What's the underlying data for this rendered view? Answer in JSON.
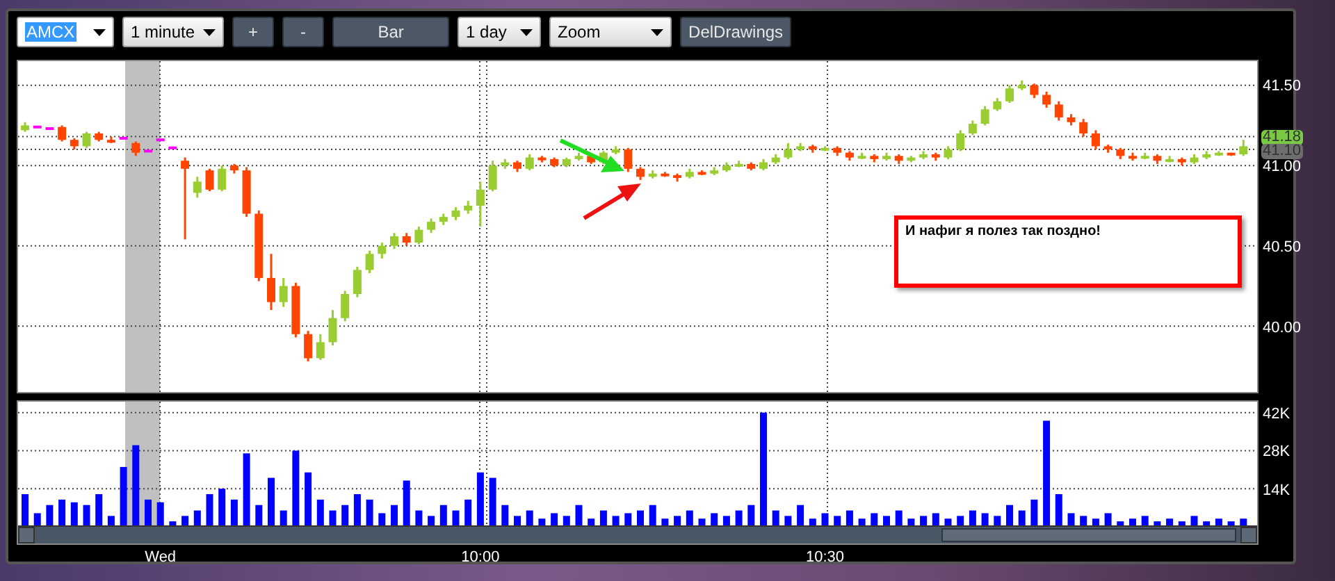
{
  "toolbar": {
    "controls": [
      {
        "kind": "input",
        "label": "AMCX",
        "text_selected": true
      },
      {
        "kind": "select",
        "label": "1 minute"
      },
      {
        "kind": "button",
        "label": "+"
      },
      {
        "kind": "button",
        "label": "-"
      },
      {
        "kind": "wide_button",
        "label": "Bar"
      },
      {
        "kind": "select",
        "label": "1 day"
      },
      {
        "kind": "wide_select",
        "label": "Zoom"
      },
      {
        "kind": "button",
        "label": "DelDrawings"
      }
    ]
  },
  "price_chart": {
    "chart_data": {
      "type": "candlestick",
      "grid": true,
      "ylim": [
        39.59,
        41.65
      ],
      "yticks": [
        {
          "value": 41.5,
          "label": "41.50"
        },
        {
          "value": 41.0,
          "label": "41.00"
        },
        {
          "value": 40.5,
          "label": "40.50"
        },
        {
          "value": 40.0,
          "label": "40.00"
        }
      ],
      "ohlc": [
        [
          41.22,
          41.27,
          41.21,
          41.25
        ],
        [
          41.24,
          41.24,
          41.24,
          41.24
        ],
        [
          41.23,
          41.23,
          41.23,
          41.23
        ],
        [
          41.24,
          41.25,
          41.15,
          41.16
        ],
        [
          41.16,
          41.17,
          41.1,
          41.12
        ],
        [
          41.12,
          41.21,
          41.11,
          41.2
        ],
        [
          41.2,
          41.21,
          41.15,
          41.16
        ],
        [
          41.16,
          41.18,
          41.14,
          41.15
        ],
        [
          41.17,
          41.17,
          41.17,
          41.17
        ],
        [
          41.14,
          41.15,
          41.06,
          41.08
        ],
        [
          41.09,
          41.09,
          41.09,
          41.09
        ],
        [
          41.16,
          41.16,
          41.16,
          41.16
        ],
        [
          41.11,
          41.11,
          41.11,
          41.11
        ],
        [
          41.03,
          41.05,
          40.54,
          40.98
        ],
        [
          40.83,
          40.93,
          40.8,
          40.9
        ],
        [
          40.97,
          40.98,
          40.84,
          40.85
        ],
        [
          40.85,
          41.0,
          40.84,
          40.98
        ],
        [
          41.0,
          41.01,
          40.95,
          40.97
        ],
        [
          40.97,
          40.99,
          40.68,
          40.7
        ],
        [
          40.7,
          40.72,
          40.28,
          40.3
        ],
        [
          40.3,
          40.45,
          40.1,
          40.15
        ],
        [
          40.15,
          40.3,
          40.12,
          40.25
        ],
        [
          40.25,
          40.27,
          39.93,
          39.95
        ],
        [
          39.95,
          39.97,
          39.78,
          39.8
        ],
        [
          39.8,
          39.95,
          39.79,
          39.9
        ],
        [
          39.9,
          40.1,
          39.88,
          40.05
        ],
        [
          40.05,
          40.22,
          40.03,
          40.2
        ],
        [
          40.2,
          40.37,
          40.18,
          40.35
        ],
        [
          40.35,
          40.47,
          40.33,
          40.45
        ],
        [
          40.45,
          40.52,
          40.42,
          40.5
        ],
        [
          40.5,
          40.58,
          40.48,
          40.56
        ],
        [
          40.56,
          40.58,
          40.5,
          40.52
        ],
        [
          40.52,
          40.62,
          40.51,
          40.6
        ],
        [
          40.6,
          40.67,
          40.58,
          40.65
        ],
        [
          40.65,
          40.7,
          40.63,
          40.68
        ],
        [
          40.68,
          40.74,
          40.66,
          40.72
        ],
        [
          40.72,
          40.78,
          40.7,
          40.75
        ],
        [
          40.75,
          40.9,
          40.62,
          40.85
        ],
        [
          40.85,
          41.03,
          40.84,
          41.0
        ],
        [
          41.0,
          41.04,
          40.98,
          41.02
        ],
        [
          41.02,
          41.03,
          40.96,
          40.98
        ],
        [
          40.98,
          41.07,
          40.97,
          41.05
        ],
        [
          41.05,
          41.06,
          41.02,
          41.04
        ],
        [
          41.04,
          41.05,
          40.99,
          41.0
        ],
        [
          41.0,
          41.05,
          40.99,
          41.04
        ],
        [
          41.04,
          41.08,
          41.03,
          41.06
        ],
        [
          41.06,
          41.07,
          41.01,
          41.02
        ],
        [
          41.02,
          41.09,
          41.01,
          41.08
        ],
        [
          41.08,
          41.12,
          41.07,
          41.1
        ],
        [
          41.1,
          41.11,
          40.96,
          40.98
        ],
        [
          40.98,
          40.99,
          40.91,
          40.93
        ],
        [
          40.93,
          40.97,
          40.92,
          40.95
        ],
        [
          40.95,
          40.96,
          40.93,
          40.94
        ],
        [
          40.94,
          40.95,
          40.9,
          40.93
        ],
        [
          40.93,
          40.98,
          40.92,
          40.96
        ],
        [
          40.96,
          40.97,
          40.94,
          40.95
        ],
        [
          40.95,
          40.99,
          40.94,
          40.97
        ],
        [
          40.97,
          41.02,
          40.96,
          41.0
        ],
        [
          41.0,
          41.03,
          40.99,
          41.01
        ],
        [
          41.01,
          41.02,
          40.97,
          40.98
        ],
        [
          40.98,
          41.04,
          40.97,
          41.02
        ],
        [
          41.02,
          41.07,
          41.01,
          41.05
        ],
        [
          41.05,
          41.14,
          41.04,
          41.1
        ],
        [
          41.1,
          41.14,
          41.09,
          41.12
        ],
        [
          41.12,
          41.13,
          41.08,
          41.1
        ],
        [
          41.1,
          41.12,
          41.09,
          41.11
        ],
        [
          41.11,
          41.12,
          41.06,
          41.08
        ],
        [
          41.08,
          41.09,
          41.03,
          41.05
        ],
        [
          41.05,
          41.08,
          41.04,
          41.06
        ],
        [
          41.06,
          41.07,
          41.02,
          41.04
        ],
        [
          41.04,
          41.08,
          41.03,
          41.06
        ],
        [
          41.06,
          41.07,
          41.01,
          41.03
        ],
        [
          41.03,
          41.06,
          41.02,
          41.05
        ],
        [
          41.05,
          41.09,
          41.04,
          41.07
        ],
        [
          41.07,
          41.08,
          41.03,
          41.05
        ],
        [
          41.05,
          41.12,
          41.04,
          41.1
        ],
        [
          41.1,
          41.22,
          41.09,
          41.2
        ],
        [
          41.2,
          41.28,
          41.19,
          41.26
        ],
        [
          41.26,
          41.37,
          41.25,
          41.35
        ],
        [
          41.35,
          41.42,
          41.34,
          41.4
        ],
        [
          41.4,
          41.5,
          41.39,
          41.48
        ],
        [
          41.48,
          41.53,
          41.47,
          41.5
        ],
        [
          41.5,
          41.51,
          41.42,
          41.44
        ],
        [
          41.44,
          41.46,
          41.36,
          41.38
        ],
        [
          41.38,
          41.4,
          41.28,
          41.3
        ],
        [
          41.3,
          41.32,
          41.25,
          41.27
        ],
        [
          41.27,
          41.29,
          41.18,
          41.2
        ],
        [
          41.2,
          41.22,
          41.1,
          41.12
        ],
        [
          41.12,
          41.13,
          41.08,
          41.1
        ],
        [
          41.1,
          41.11,
          41.04,
          41.06
        ],
        [
          41.06,
          41.08,
          41.03,
          41.05
        ],
        [
          41.05,
          41.08,
          41.04,
          41.06
        ],
        [
          41.06,
          41.07,
          41.01,
          41.03
        ],
        [
          41.03,
          41.06,
          41.02,
          41.04
        ],
        [
          41.04,
          41.05,
          41.0,
          41.02
        ],
        [
          41.02,
          41.07,
          41.01,
          41.05
        ],
        [
          41.05,
          41.09,
          41.04,
          41.07
        ],
        [
          41.07,
          41.09,
          41.06,
          41.08
        ],
        [
          41.08,
          41.08,
          41.06,
          41.07
        ],
        [
          41.07,
          41.16,
          41.06,
          41.12
        ]
      ]
    },
    "last_tags": [
      {
        "label": "41.18",
        "color": "#7ac943"
      },
      {
        "label": "41.10",
        "color": "#6e6e6e"
      }
    ],
    "note": "И нафиг я полез так поздно!"
  },
  "volume_chart": {
    "chart_data": {
      "type": "bar",
      "grid": true,
      "ylim": [
        0,
        46000
      ],
      "yticks": [
        {
          "value": 14000,
          "label": "14K"
        },
        {
          "value": 28000,
          "label": "28K"
        },
        {
          "value": 42000,
          "label": "42K"
        }
      ],
      "values": [
        12000,
        5000,
        8000,
        10000,
        9000,
        8000,
        12000,
        4000,
        22000,
        30000,
        10000,
        9000,
        2000,
        4000,
        6000,
        12000,
        14000,
        10000,
        27000,
        8000,
        18000,
        6000,
        28000,
        20000,
        10000,
        6000,
        8000,
        12000,
        10000,
        5000,
        8000,
        17000,
        6000,
        4000,
        8000,
        6000,
        10000,
        20000,
        18000,
        8000,
        4000,
        6000,
        3000,
        5000,
        4000,
        8000,
        3000,
        6000,
        4000,
        5000,
        6000,
        8000,
        3000,
        4000,
        6000,
        3000,
        5000,
        4000,
        6000,
        8000,
        42000,
        6000,
        4000,
        8000,
        3000,
        5000,
        4000,
        6000,
        3000,
        5000,
        4000,
        6000,
        3000,
        4000,
        5000,
        3000,
        4000,
        6000,
        5000,
        4000,
        8000,
        6000,
        10000,
        39000,
        12000,
        5000,
        4000,
        3000,
        5000,
        2000,
        3000,
        4000,
        2000,
        3000,
        2000,
        4000,
        2000,
        3000,
        2000,
        3000
      ]
    }
  },
  "time_axis": [
    "Wed",
    "10:00",
    "10:30"
  ]
}
